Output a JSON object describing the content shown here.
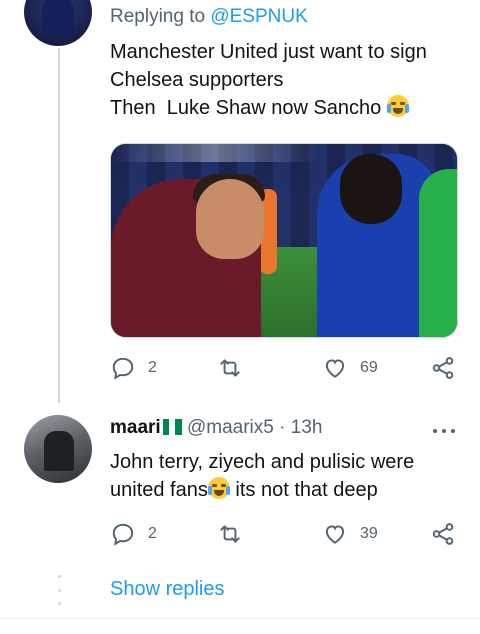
{
  "tweet1": {
    "replying_prefix": "Replying to",
    "replying_handle": "@ESPNUK",
    "lines": [
      "Manchester United just want to sign",
      "Chelsea supporters",
      "Then  Luke Shaw now Sancho"
    ],
    "emoji": "crying-face",
    "actions": {
      "reply_count": "2",
      "retweet_count": "",
      "like_count": "69"
    }
  },
  "tweet2": {
    "display_name": "maari",
    "flag_colors": [
      "#008751",
      "#ffffff",
      "#008751"
    ],
    "handle": "@maarix5",
    "separator": "·",
    "time": "13h",
    "lines": [
      "John terry, ziyech and pulisic were",
      "united fans",
      "its not that deep"
    ],
    "emoji": "tears-of-joy",
    "actions": {
      "reply_count": "2",
      "retweet_count": "",
      "like_count": "39"
    }
  },
  "show_replies_label": "Show replies",
  "colors": {
    "accent": "#1d9bf0",
    "muted": "#536471",
    "text": "#0f1419",
    "divider": "#cfd9de"
  }
}
